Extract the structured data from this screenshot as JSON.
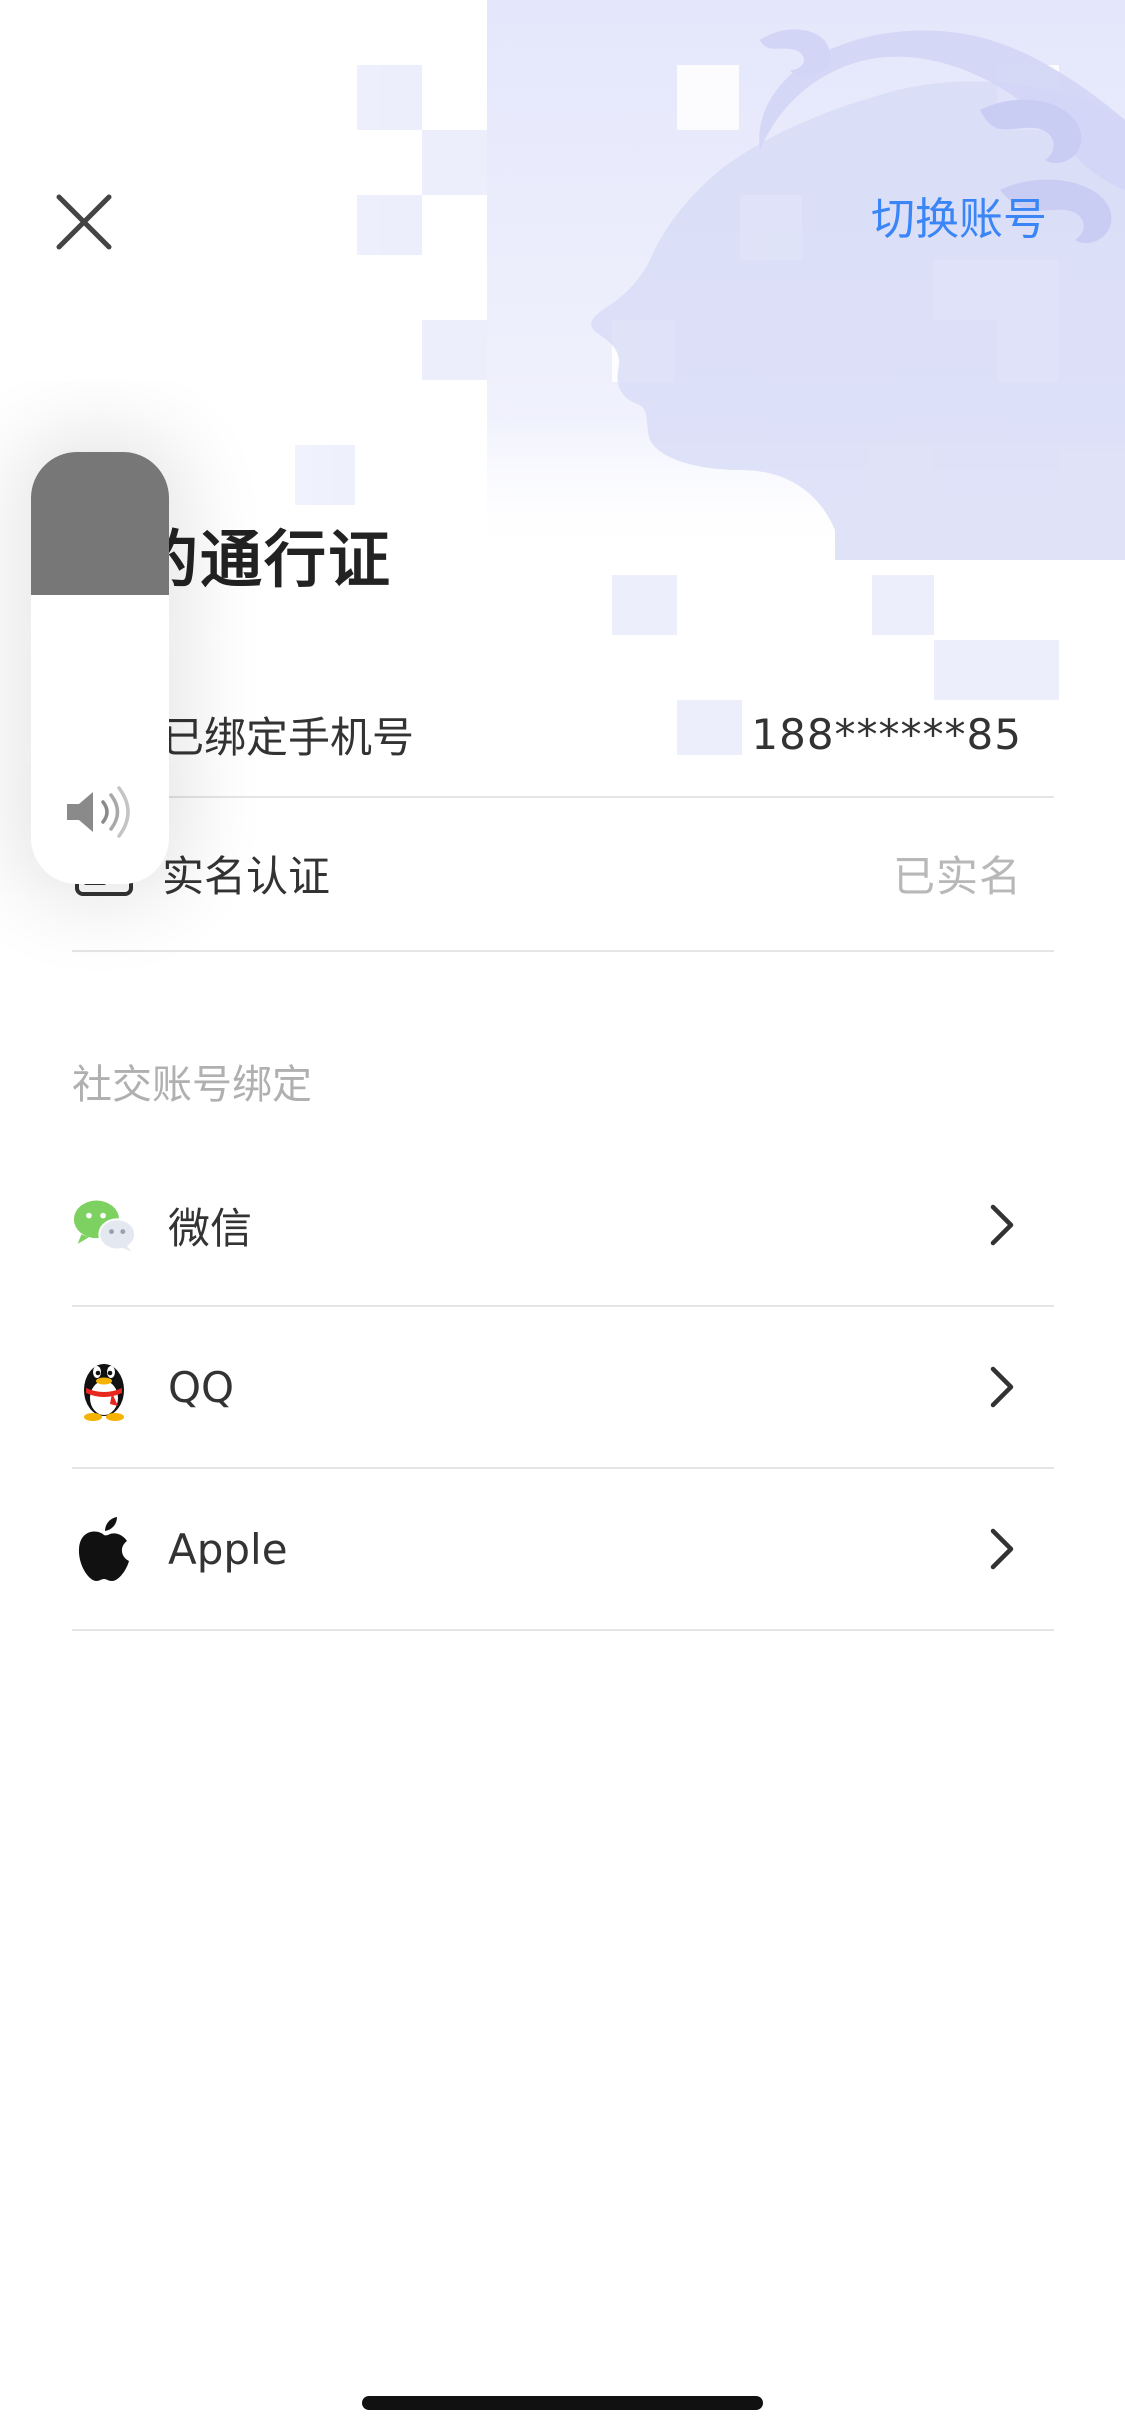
{
  "header": {
    "switch_account_label": "切换账号",
    "title": "我的通行证"
  },
  "account_rows": [
    {
      "label": "已绑定手机号",
      "value": "188******85",
      "value_color": "#333333"
    },
    {
      "label": "实名认证",
      "value": "已实名",
      "value_color": "#b8b8b8"
    }
  ],
  "social": {
    "section_label": "社交账号绑定",
    "items": [
      {
        "label": "微信",
        "icon": "wechat-icon"
      },
      {
        "label": "QQ",
        "icon": "qq-icon"
      },
      {
        "label": "Apple",
        "icon": "apple-icon"
      }
    ]
  },
  "volume_hud": {
    "level": 0.33,
    "icon": "speaker-icon"
  },
  "colors": {
    "accent": "#3a86f7",
    "background_art": "#e3e5fb",
    "divider": "#e5e5e5"
  }
}
